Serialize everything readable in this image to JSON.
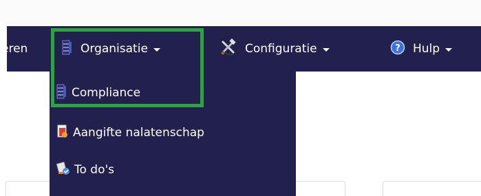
{
  "navbar": {
    "partial_item_label": "eren",
    "items": [
      {
        "label": "Organisatie",
        "icon": "binder-icon"
      },
      {
        "label": "Configuratie",
        "icon": "tools-icon"
      },
      {
        "label": "Hulp",
        "icon": "help-icon"
      }
    ]
  },
  "dropdown": {
    "items": [
      {
        "label": "Compliance",
        "icon": "binder-icon"
      },
      {
        "label": "Aangifte nalatenschap",
        "icon": "document-icon"
      },
      {
        "label": "To do's",
        "icon": "todo-icon"
      }
    ]
  },
  "colors": {
    "navbar_bg": "#22214d",
    "highlight": "#2aa63d",
    "text": "#ffffff"
  }
}
